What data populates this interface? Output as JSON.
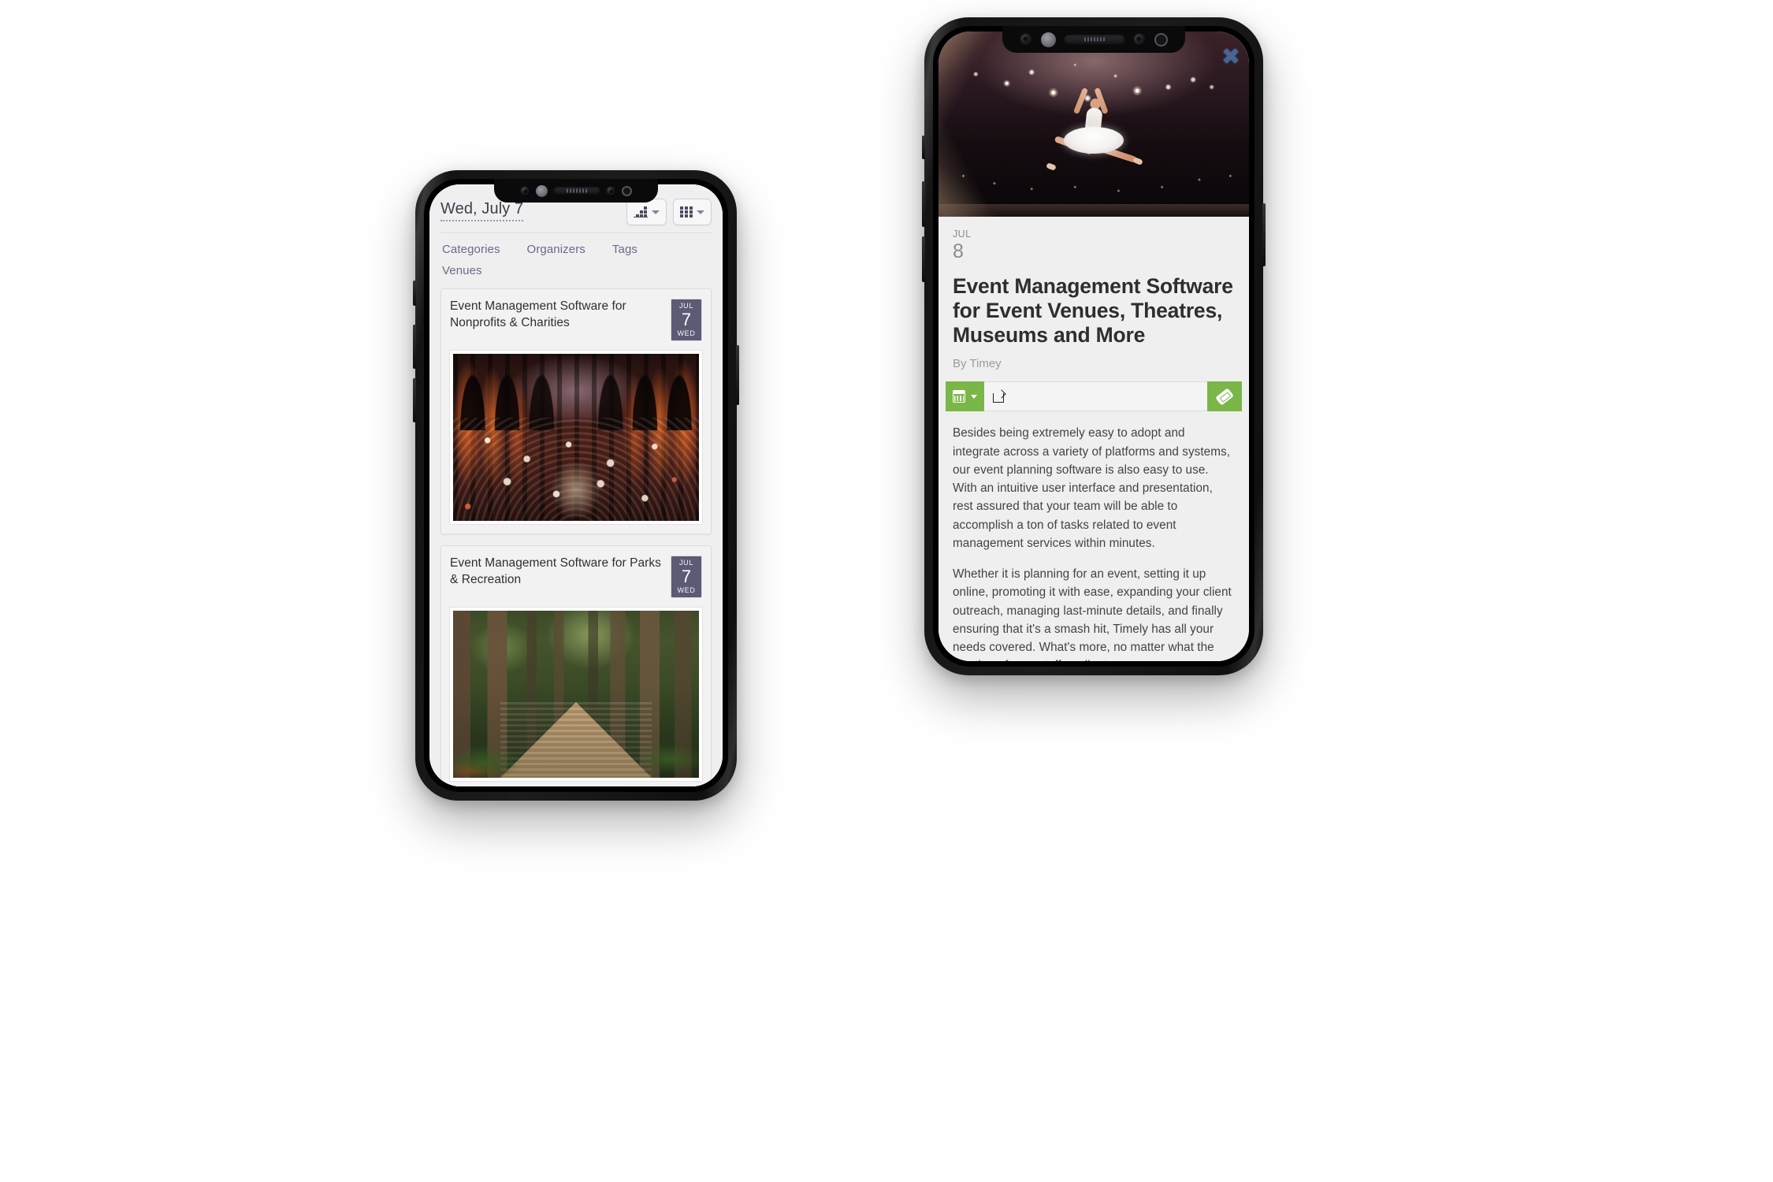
{
  "colors": {
    "badge_purple": "#5c5a75",
    "action_green": "#7ab648",
    "link_lavender": "#6a6a8c",
    "screen_bg": "#efefef"
  },
  "left_phone": {
    "name": "agenda-list-view",
    "topbar": {
      "date_label": "Wed, July 7",
      "view_buttons": [
        {
          "icon": "agenda-view-icon",
          "caret": "chevron-down-icon",
          "label": "Agenda view"
        },
        {
          "icon": "grid-view-icon",
          "caret": "chevron-down-icon",
          "label": "Tile view"
        }
      ]
    },
    "filters": [
      {
        "label": "Categories"
      },
      {
        "label": "Organizers"
      },
      {
        "label": "Tags"
      },
      {
        "label": "Venues"
      }
    ],
    "events": [
      {
        "title": "Event Management Software for Nonprofits & Charities",
        "badge": {
          "month": "JUL",
          "day": "7",
          "weekday": "WED"
        },
        "image": "banquet-hall-photo"
      },
      {
        "title": "Event Management Software for Parks & Recreation",
        "badge": {
          "month": "JUL",
          "day": "7",
          "weekday": "WED"
        },
        "image": "forest-boardwalk-photo"
      }
    ]
  },
  "right_phone": {
    "name": "event-detail-view",
    "hero": {
      "image": "ballerina-on-stage-photo",
      "close_icon": "close-icon"
    },
    "date": {
      "month": "JUL",
      "day": "8"
    },
    "title": "Event Management Software for Event Venues, Theatres, Museums and More",
    "byline": "By Timey",
    "actions": {
      "add_to_calendar": {
        "icon": "calendar-icon",
        "caret": "chevron-down-icon",
        "label": "Add to calendar"
      },
      "share": {
        "icon": "share-icon",
        "label": "Share"
      },
      "tickets": {
        "icon": "ticket-icon",
        "label": "Get tickets"
      }
    },
    "paragraphs": [
      "Besides being extremely easy to adopt and integrate across a variety of platforms and systems, our event planning software is also easy to use. With an intuitive user interface and presentation, rest assured that your team will be able to accomplish a ton of tasks related to event management services within minutes.",
      "Whether it is planning for an event, setting it up online, promoting it with ease, expanding your client outreach, managing last-minute details, and finally ensuring that it's a smash hit, Timely has all your needs covered. What's more, no matter what the location of your staff or clients,"
    ]
  }
}
